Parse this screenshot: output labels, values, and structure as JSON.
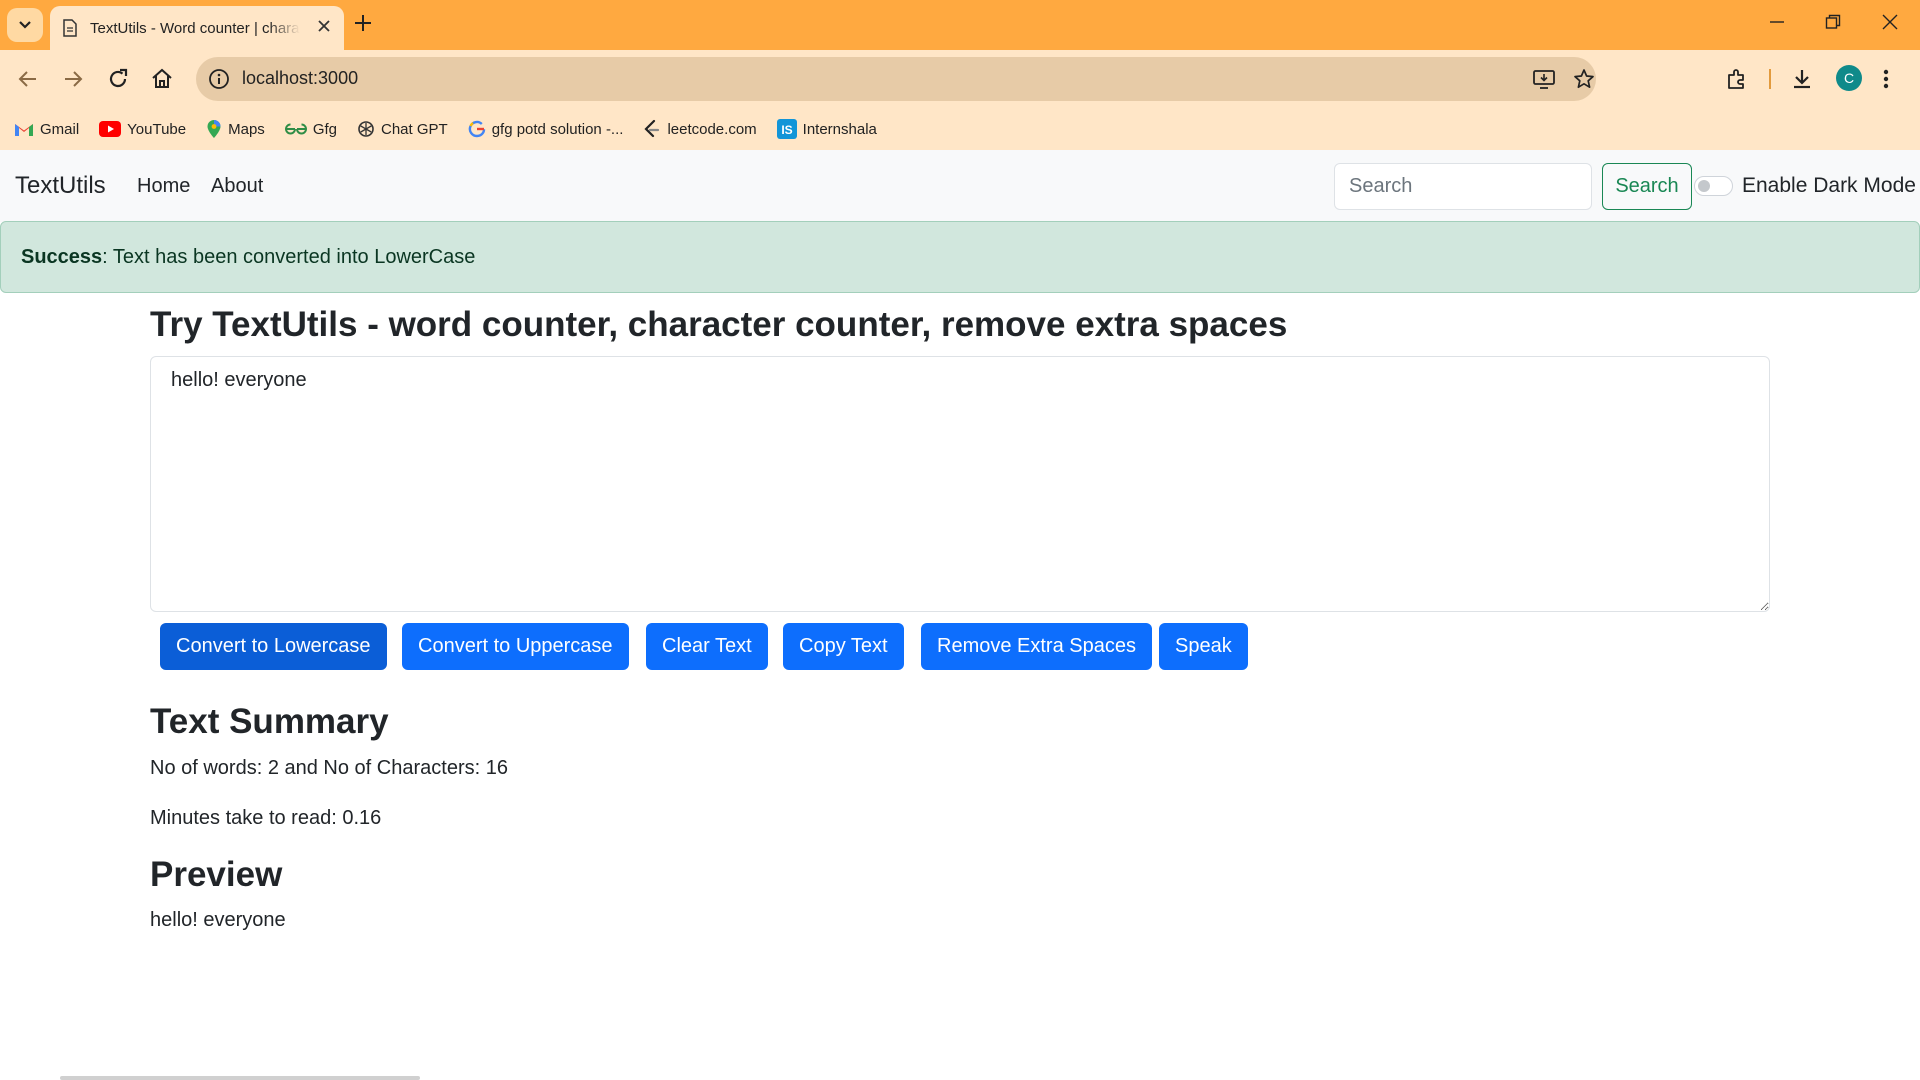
{
  "browser": {
    "tab_title": "TextUtils - Word counter | character counter",
    "url": "localhost:3000",
    "avatar_letter": "C",
    "bookmarks": [
      {
        "label": "Gmail",
        "icon": "gmail-icon"
      },
      {
        "label": "YouTube",
        "icon": "youtube-icon"
      },
      {
        "label": "Maps",
        "icon": "maps-icon"
      },
      {
        "label": "Gfg",
        "icon": "gfg-icon"
      },
      {
        "label": "Chat GPT",
        "icon": "chatgpt-icon"
      },
      {
        "label": "gfg potd solution -...",
        "icon": "google-icon"
      },
      {
        "label": "leetcode.com",
        "icon": "leetcode-icon"
      },
      {
        "label": "Internshala",
        "icon": "internshala-icon"
      }
    ],
    "colors": {
      "tabbar": "#ffa940",
      "toolbar": "#ffe6c7"
    }
  },
  "navbar": {
    "brand": "TextUtils",
    "links": [
      "Home",
      "About"
    ],
    "search_placeholder": "Search",
    "search_button": "Search",
    "dark_mode_label": "Enable Dark Mode",
    "dark_mode_enabled": false
  },
  "alert": {
    "type": "Success",
    "message": ": Text has been converted into LowerCase",
    "color": "#d1e7dd"
  },
  "main": {
    "title": "Try TextUtils - word counter, character counter, remove extra spaces",
    "textarea_value": "hello! everyone",
    "buttons": [
      "Convert to Lowercase",
      "Convert to Uppercase",
      "Clear Text",
      "Copy Text",
      "Remove Extra Spaces",
      "Speak"
    ],
    "button_color": "#0d6efd"
  },
  "summary": {
    "heading": "Text Summary",
    "counts": "No of words: 2 and No of Characters: 16",
    "read_time": "Minutes take to read: 0.16"
  },
  "preview": {
    "heading": "Preview",
    "text": "hello! everyone"
  }
}
